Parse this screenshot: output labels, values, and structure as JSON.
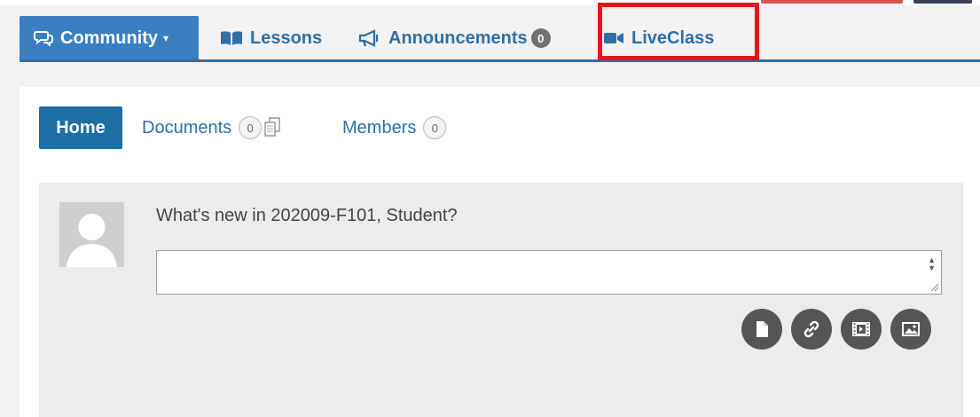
{
  "nav": {
    "community": "Community",
    "lessons": "Lessons",
    "announcements": "Announcements",
    "announcements_count": "0",
    "liveclass": "LiveClass"
  },
  "subnav": {
    "home": "Home",
    "documents": "Documents",
    "documents_count": "0",
    "members": "Members",
    "members_count": "0"
  },
  "post": {
    "prompt": "What's new in 202009-F101, Student?",
    "input_value": ""
  },
  "colors": {
    "nav_active": "#3a7fc1",
    "link": "#2f6fa7",
    "highlight": "#e8141c"
  }
}
